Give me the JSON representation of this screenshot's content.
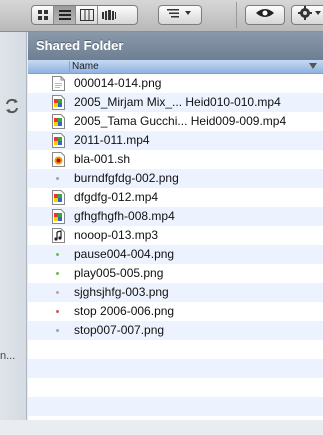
{
  "window": {
    "folder_title": "Shared Folder"
  },
  "toolbar": {
    "view_buttons": [
      "icon-view-icon",
      "list-view-icon",
      "column-view-icon",
      "coverflow-view-icon"
    ],
    "active_view": "list-view-icon",
    "arrange_icon": "arrange-icon",
    "quicklook_icon": "eye-icon",
    "action_icon": "gear-icon"
  },
  "sidebar": {
    "sync_icon": "sync-icon",
    "truncated_text": "n..."
  },
  "list": {
    "column_name": "Name",
    "files": [
      {
        "name": "000014-014.png",
        "icon": "png-file-icon"
      },
      {
        "name": "2005_Mirjam Mix_... Heid010-010.mp4",
        "icon": "mp4-file-icon"
      },
      {
        "name": "2005_Tama Gucchi... Heid009-009.mp4",
        "icon": "mp4-file-icon"
      },
      {
        "name": "2011-011.mp4",
        "icon": "mp4-file-icon"
      },
      {
        "name": "bla-001.sh",
        "icon": "sh-file-icon"
      },
      {
        "name": "burndfgfdg-002.png",
        "icon": "png-thumb-icon"
      },
      {
        "name": "dfgdfg-012.mp4",
        "icon": "mp4-file-icon"
      },
      {
        "name": "gfhgfhgfh-008.mp4",
        "icon": "mp4-file-icon"
      },
      {
        "name": "nooop-013.mp3",
        "icon": "mp3-file-icon"
      },
      {
        "name": "pause004-004.png",
        "icon": "png-thumb-icon"
      },
      {
        "name": "play005-005.png",
        "icon": "png-thumb-icon"
      },
      {
        "name": "sjghsjhfg-003.png",
        "icon": "png-thumb-icon"
      },
      {
        "name": "stop 2006-006.png",
        "icon": "png-thumb-icon"
      },
      {
        "name": "stop007-007.png",
        "icon": "png-thumb-icon"
      }
    ]
  },
  "colors": {
    "header_bg": "#7a8b9e",
    "column_header": "#a9c5ea",
    "alt_row": "#edf3fe"
  }
}
